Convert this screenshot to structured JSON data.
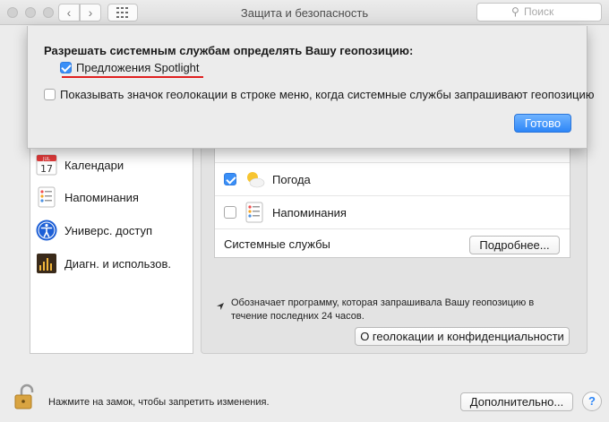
{
  "window": {
    "title": "Защита и безопасность"
  },
  "toolbar": {
    "search_placeholder": "Поиск"
  },
  "sidebar": {
    "items": [
      {
        "label": "Календари",
        "icon": "calendar-icon",
        "day": "17",
        "month": "JUL"
      },
      {
        "label": "Напоминания",
        "icon": "reminders-icon"
      },
      {
        "label": "Универс. доступ",
        "icon": "accessibility-icon"
      },
      {
        "label": "Диагн. и использов.",
        "icon": "diagnostics-icon"
      }
    ]
  },
  "services": {
    "rows": [
      {
        "label": "Погода",
        "checked": true,
        "icon": "weather-icon"
      },
      {
        "label": "Напоминания",
        "checked": false,
        "icon": "reminders-icon"
      }
    ],
    "system": {
      "label": "Системные службы",
      "button": "Подробнее..."
    }
  },
  "note": {
    "text": "Обозначает программу, которая запрашивала Вашу геопозицию в течение последних 24 часов."
  },
  "privacy_button": "О геолокации и конфиденциальности",
  "footer": {
    "lock_text": "Нажмите на замок, чтобы запретить изменения.",
    "advanced_button": "Дополнительно...",
    "help": "?"
  },
  "sheet": {
    "title": "Разрешать системным службам определять Вашу геопозицию:",
    "spotlight": {
      "label": "Предложения Spotlight",
      "checked": true
    },
    "menu_icon": {
      "label": "Показывать значок геолокации в строке меню, когда системные службы запрашивают геопозицию",
      "checked": false
    },
    "done_button": "Готово"
  },
  "colors": {
    "accent": "#2d86f7",
    "highlight": "#e02020"
  }
}
